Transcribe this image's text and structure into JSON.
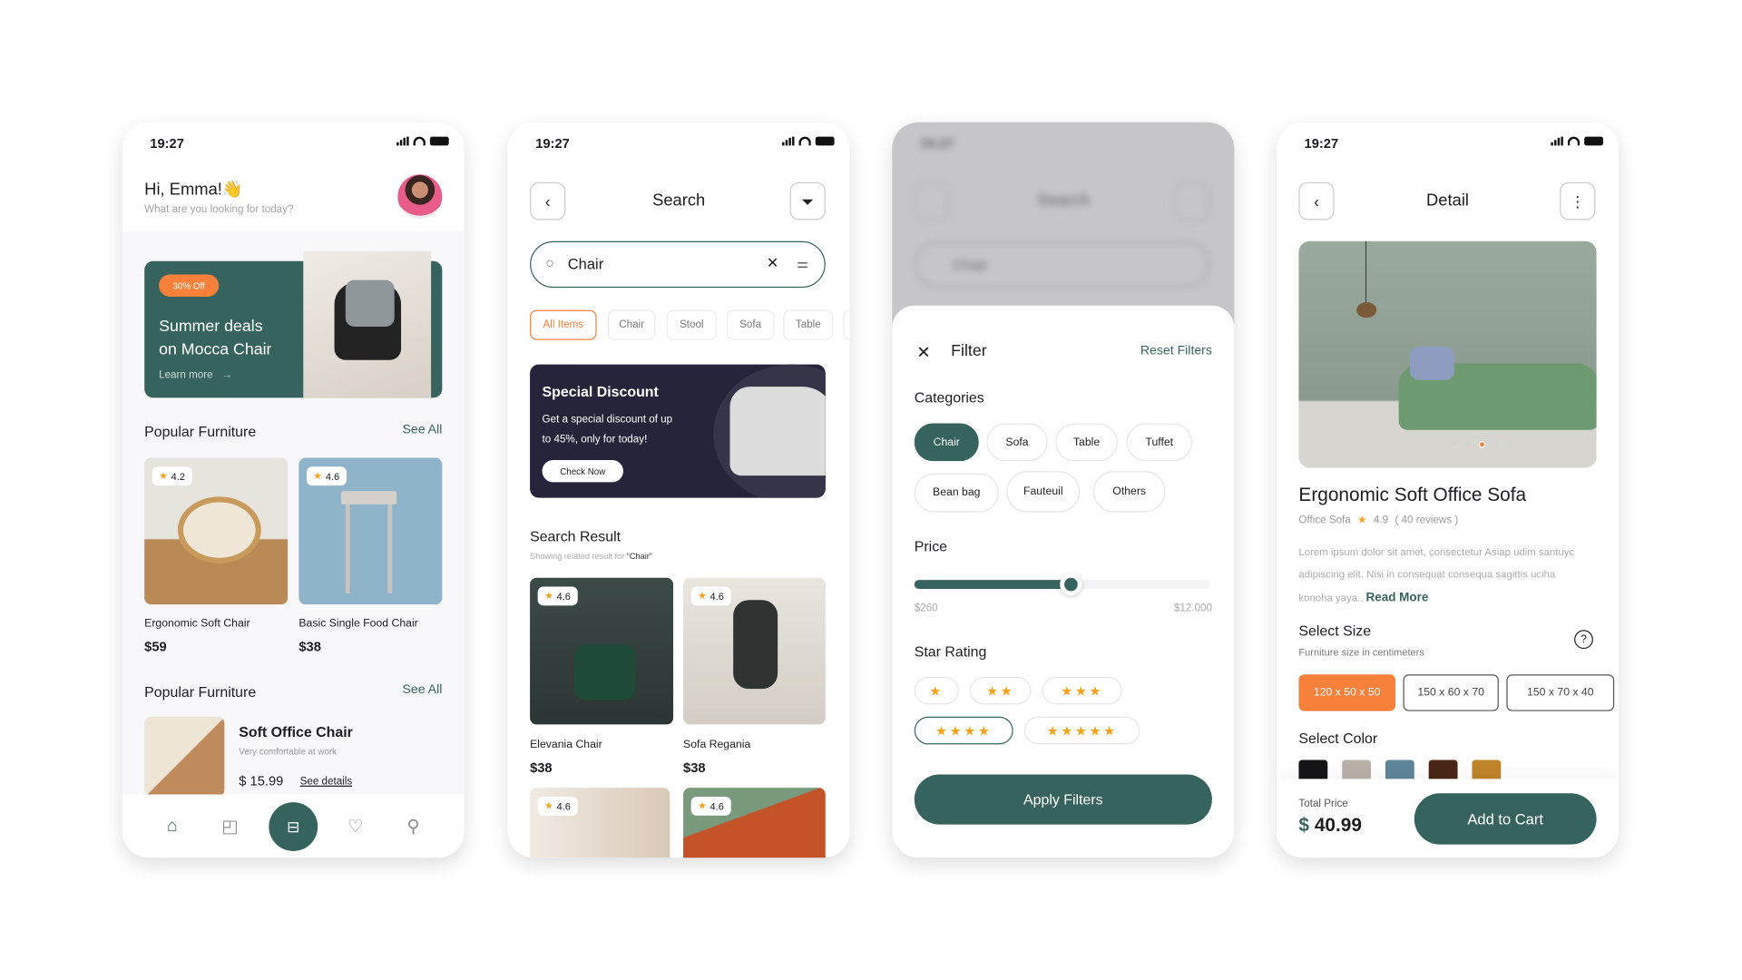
{
  "status_time": "19:27",
  "home": {
    "greeting": "Hi, Emma!👋",
    "subtitle": "What are you looking for today?",
    "promo": {
      "badge": "30% Off",
      "title_line1": "Summer deals",
      "title_line2": "on Mocca Chair",
      "link": "Learn more"
    },
    "section1": {
      "title": "Popular Furniture",
      "see_all": "See All"
    },
    "products": [
      {
        "rating": "4.2",
        "name": "Ergonomic Soft  Chair",
        "price": "$59"
      },
      {
        "rating": "4.6",
        "name": "Basic Single Food Chair",
        "price": "$38"
      }
    ],
    "section2": {
      "title": "Popular Furniture",
      "see_all": "See All"
    },
    "list_item": {
      "name": "Soft Office Chair",
      "desc": "Very comfortable at work",
      "price": "$ 15.99",
      "link": "See details"
    },
    "nav": [
      "home",
      "bag",
      "scan",
      "heart",
      "profile"
    ]
  },
  "search": {
    "title": "Search",
    "query": "Chair",
    "chips": [
      "All Items",
      "Chair",
      "Stool",
      "Sofa",
      "Table"
    ],
    "active_chip": "All Items",
    "banner": {
      "title": "Special Discount",
      "text_line1": "Get a special discount of up",
      "text_line2": "to 45%, only for today!",
      "button": "Check Now"
    },
    "result_title": "Search Result",
    "result_sub_prefix": "Showing related result for ",
    "result_sub_query": "“Chair”",
    "results": [
      {
        "rating": "4.6",
        "name": "Elevania Chair",
        "price": "$38"
      },
      {
        "rating": "4.6",
        "name": "Sofa Regania",
        "price": "$38"
      },
      {
        "rating": "4.6"
      },
      {
        "rating": "4.6"
      }
    ]
  },
  "filter": {
    "title": "Filter",
    "reset": "Reset Filters",
    "categories_title": "Categories",
    "categories": [
      "Chair",
      "Sofa",
      "Table",
      "Tuffet",
      "Bean bag",
      "Fauteuil",
      "Others"
    ],
    "selected_category": "Chair",
    "price_title": "Price",
    "price_min": "$260",
    "price_max": "$12.000",
    "price_slider_fraction": 0.53,
    "rating_title": "Star Rating",
    "star_options": [
      1,
      2,
      3,
      4,
      5
    ],
    "selected_stars": 4,
    "apply": "Apply Filters",
    "bg_title": "Search",
    "bg_query": "Chair"
  },
  "detail": {
    "title": "Detail",
    "product_name": "Ergonomic Soft Office Sofa",
    "category": "Office Sofa",
    "rating": "4.9",
    "reviews": "( 40 reviews )",
    "description": "Lorem ipsum dolor sit amet, consectetur Asiap udim santuyc adipiscing elit. Nisi in consequat consequa sagittis uciha konoha yaya..",
    "read_more": "Read More",
    "size_title": "Select Size",
    "size_sub": "Furniture size in centimeters",
    "sizes": [
      "120 x 50 x 50",
      "150 x 60 x 70",
      "150 x 70 x 40"
    ],
    "color_title": "Select Color",
    "colors": [
      "#151517",
      "#b9b0aa",
      "#5f8599",
      "#4a2716",
      "#c0852a"
    ],
    "total_label": "Total Price",
    "currency": "$",
    "total": "40.99",
    "cart_button": "Add to Cart"
  },
  "colors": {
    "primary": "#37635e",
    "accent": "#f7803b",
    "banner": "#25243a"
  }
}
